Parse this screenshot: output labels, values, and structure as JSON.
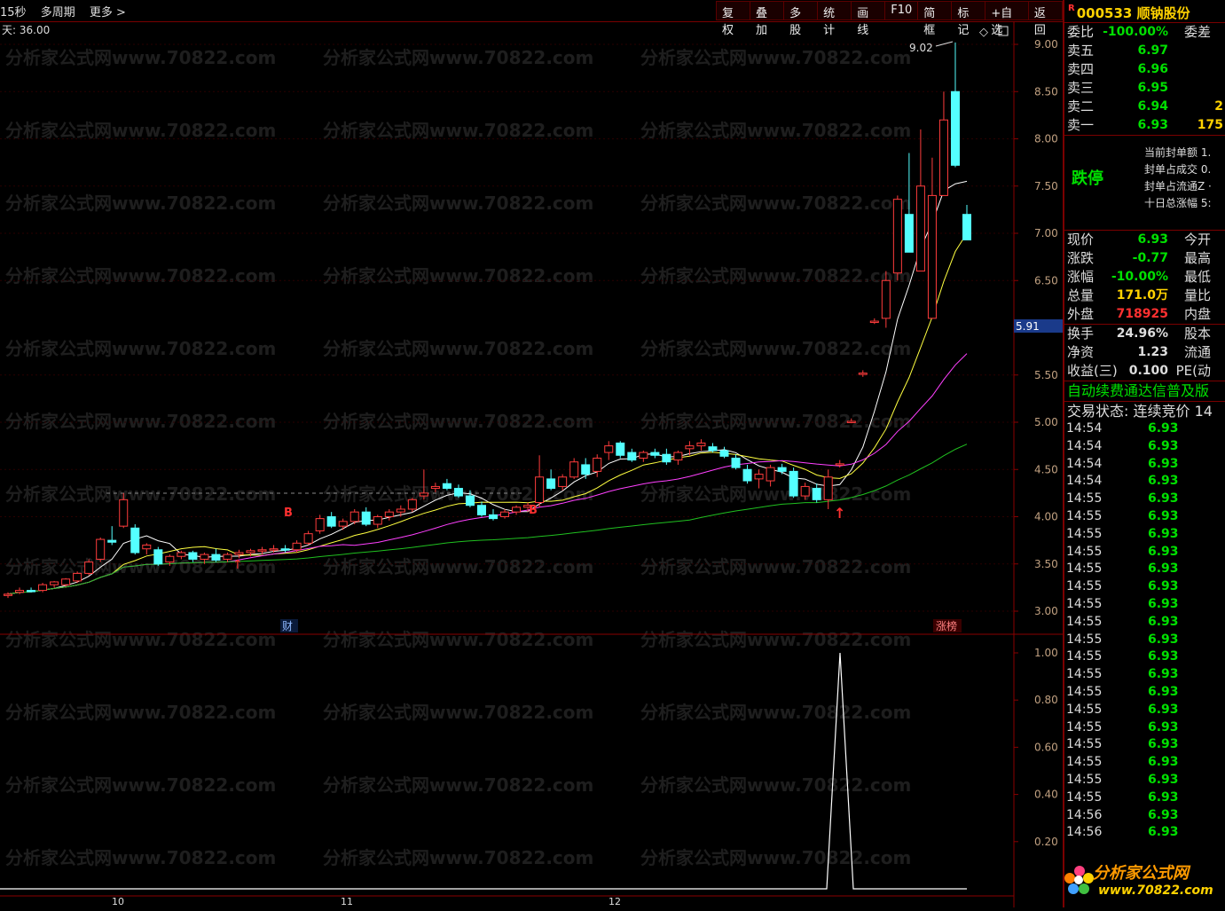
{
  "toolbar": {
    "left_items": [
      "15秒",
      "多周期",
      "更多 >"
    ],
    "buttons": [
      "复权",
      "叠加",
      "多股",
      "统计",
      "画线",
      "F10",
      "简框",
      "标记",
      "+自选",
      "返回"
    ]
  },
  "chart": {
    "corner_label": "天: 36.00",
    "watermark": "分析家公式网www.70822.com",
    "price_marker": "9.02",
    "current_price_badge": "5.91",
    "badge_cai": "财",
    "badge_zhang": "涨榜",
    "label_b": "B",
    "month_labels": [
      "10",
      "11",
      "12"
    ],
    "price_ticks": [
      "9.00",
      "8.50",
      "8.00",
      "7.50",
      "7.00",
      "6.50",
      "5.50",
      "5.00",
      "4.50",
      "4.00",
      "3.50",
      "3.00"
    ],
    "indicator_ticks": [
      "1.00",
      "0.80",
      "0.60",
      "0.40",
      "0.20"
    ]
  },
  "chart_data": {
    "type": "candlestick",
    "title": "",
    "ylim": [
      2.9,
      9.3
    ],
    "candles": [
      [
        3.17,
        3.2,
        3.14,
        3.18
      ],
      [
        3.2,
        3.25,
        3.18,
        3.22
      ],
      [
        3.22,
        3.25,
        3.2,
        3.21
      ],
      [
        3.22,
        3.3,
        3.2,
        3.28
      ],
      [
        3.28,
        3.32,
        3.25,
        3.31
      ],
      [
        3.28,
        3.35,
        3.26,
        3.34
      ],
      [
        3.32,
        3.42,
        3.3,
        3.4
      ],
      [
        3.4,
        3.55,
        3.38,
        3.52
      ],
      [
        3.55,
        3.78,
        3.52,
        3.76
      ],
      [
        3.75,
        3.9,
        3.7,
        3.73
      ],
      [
        3.9,
        4.25,
        3.88,
        4.18
      ],
      [
        3.88,
        3.92,
        3.6,
        3.62
      ],
      [
        3.66,
        3.72,
        3.6,
        3.7
      ],
      [
        3.65,
        3.68,
        3.48,
        3.5
      ],
      [
        3.52,
        3.6,
        3.48,
        3.58
      ],
      [
        3.58,
        3.64,
        3.55,
        3.62
      ],
      [
        3.62,
        3.64,
        3.52,
        3.55
      ],
      [
        3.55,
        3.62,
        3.5,
        3.6
      ],
      [
        3.6,
        3.66,
        3.52,
        3.54
      ],
      [
        3.55,
        3.62,
        3.52,
        3.6
      ],
      [
        3.6,
        3.65,
        3.56,
        3.62
      ],
      [
        3.62,
        3.66,
        3.58,
        3.64
      ],
      [
        3.64,
        3.68,
        3.6,
        3.65
      ],
      [
        3.65,
        3.7,
        3.62,
        3.66
      ],
      [
        3.66,
        3.7,
        3.62,
        3.65
      ],
      [
        3.65,
        3.75,
        3.62,
        3.72
      ],
      [
        3.72,
        3.85,
        3.7,
        3.82
      ],
      [
        3.85,
        4.02,
        3.82,
        3.98
      ],
      [
        4.0,
        4.05,
        3.88,
        3.9
      ],
      [
        3.9,
        3.98,
        3.86,
        3.95
      ],
      [
        3.95,
        4.08,
        3.92,
        4.05
      ],
      [
        4.05,
        4.1,
        3.9,
        3.92
      ],
      [
        3.92,
        4.02,
        3.88,
        4.0
      ],
      [
        4.0,
        4.08,
        3.96,
        4.05
      ],
      [
        4.05,
        4.12,
        4.0,
        4.08
      ],
      [
        4.08,
        4.2,
        4.05,
        4.18
      ],
      [
        4.22,
        4.5,
        4.18,
        4.25
      ],
      [
        4.3,
        4.36,
        4.26,
        4.32
      ],
      [
        4.35,
        4.4,
        4.28,
        4.3
      ],
      [
        4.3,
        4.34,
        4.2,
        4.22
      ],
      [
        4.22,
        4.28,
        4.1,
        4.12
      ],
      [
        4.12,
        4.16,
        4.0,
        4.02
      ],
      [
        4.02,
        4.08,
        3.96,
        3.98
      ],
      [
        4.0,
        4.08,
        3.98,
        4.05
      ],
      [
        4.05,
        4.12,
        4.02,
        4.1
      ],
      [
        4.1,
        4.15,
        4.05,
        4.12
      ],
      [
        4.15,
        4.65,
        4.1,
        4.42
      ],
      [
        4.4,
        4.5,
        4.28,
        4.3
      ],
      [
        4.32,
        4.45,
        4.28,
        4.42
      ],
      [
        4.42,
        4.62,
        4.4,
        4.58
      ],
      [
        4.55,
        4.62,
        4.4,
        4.45
      ],
      [
        4.48,
        4.66,
        4.42,
        4.62
      ],
      [
        4.68,
        4.8,
        4.6,
        4.75
      ],
      [
        4.78,
        4.8,
        4.62,
        4.65
      ],
      [
        4.68,
        4.72,
        4.58,
        4.6
      ],
      [
        4.62,
        4.7,
        4.58,
        4.68
      ],
      [
        4.68,
        4.72,
        4.62,
        4.65
      ],
      [
        4.66,
        4.72,
        4.55,
        4.58
      ],
      [
        4.6,
        4.7,
        4.55,
        4.68
      ],
      [
        4.72,
        4.8,
        4.65,
        4.75
      ],
      [
        4.75,
        4.82,
        4.7,
        4.78
      ],
      [
        4.74,
        4.78,
        4.68,
        4.7
      ],
      [
        4.7,
        4.74,
        4.62,
        4.64
      ],
      [
        4.62,
        4.66,
        4.5,
        4.52
      ],
      [
        4.5,
        4.55,
        4.35,
        4.38
      ],
      [
        4.4,
        4.5,
        4.3,
        4.45
      ],
      [
        4.38,
        4.55,
        4.32,
        4.52
      ],
      [
        4.52,
        4.56,
        4.45,
        4.48
      ],
      [
        4.48,
        4.52,
        4.2,
        4.22
      ],
      [
        4.22,
        4.36,
        4.18,
        4.32
      ],
      [
        4.3,
        4.35,
        4.15,
        4.18
      ],
      [
        4.18,
        4.5,
        4.08,
        4.42
      ],
      [
        4.55,
        4.6,
        4.52,
        4.56
      ],
      [
        5.01,
        5.04,
        4.99,
        5.01
      ],
      [
        5.52,
        5.55,
        5.48,
        5.52
      ],
      [
        6.07,
        6.1,
        6.04,
        6.07
      ],
      [
        6.1,
        6.6,
        6.0,
        6.5
      ],
      [
        6.58,
        7.4,
        6.5,
        7.36
      ],
      [
        7.2,
        7.85,
        6.8,
        6.8
      ],
      [
        6.6,
        8.1,
        6.6,
        7.5
      ],
      [
        6.1,
        7.8,
        6.1,
        7.4
      ],
      [
        7.4,
        8.5,
        7.4,
        8.2
      ],
      [
        8.5,
        9.02,
        7.7,
        7.72
      ],
      [
        7.2,
        7.3,
        6.93,
        6.93
      ]
    ]
  },
  "quote": {
    "code": "000533",
    "name": "顺钠股份",
    "rows1": [
      {
        "label": "委比",
        "value": "-100.00%",
        "extra": "委差",
        "vol": ""
      },
      {
        "label": "卖五",
        "value": "6.97",
        "extra": "",
        "vol": ""
      },
      {
        "label": "卖四",
        "value": "6.96",
        "extra": "",
        "vol": ""
      },
      {
        "label": "卖三",
        "value": "6.95",
        "extra": "",
        "vol": ""
      },
      {
        "label": "卖二",
        "value": "6.94",
        "extra": "",
        "vol": "2"
      },
      {
        "label": "卖一",
        "value": "6.93",
        "extra": "",
        "vol": "175"
      }
    ],
    "limit_label": "跌停",
    "limit_items": [
      "当前封单额 1.",
      "封单占成交 0.",
      "封单占流通Z ·",
      "十日总涨幅 5:"
    ],
    "rows2": [
      {
        "label": "现价",
        "value": "6.93",
        "extra": "今开"
      },
      {
        "label": "涨跌",
        "value": "-0.77",
        "extra": "最高"
      },
      {
        "label": "涨幅",
        "value": "-10.00%",
        "extra": "最低"
      },
      {
        "label": "总量",
        "value": "171.0万",
        "extra": "量比"
      },
      {
        "label": "外盘",
        "value": "718925",
        "extra": "内盘"
      }
    ],
    "rows3": [
      {
        "label": "换手",
        "value": "24.96%",
        "extra": "股本"
      },
      {
        "label": "净资",
        "value": "1.23",
        "extra": "流通"
      },
      {
        "label": "收益(三)",
        "value": "0.100",
        "extra": "PE(动"
      }
    ],
    "ticker": "自动续费通达信普及版",
    "status": "交易状态: 连续竞价 14",
    "ticks": [
      {
        "t": "14:54",
        "p": "6.93"
      },
      {
        "t": "14:54",
        "p": "6.93"
      },
      {
        "t": "14:54",
        "p": "6.93"
      },
      {
        "t": "14:54",
        "p": "6.93"
      },
      {
        "t": "14:55",
        "p": "6.93"
      },
      {
        "t": "14:55",
        "p": "6.93"
      },
      {
        "t": "14:55",
        "p": "6.93"
      },
      {
        "t": "14:55",
        "p": "6.93"
      },
      {
        "t": "14:55",
        "p": "6.93"
      },
      {
        "t": "14:55",
        "p": "6.93"
      },
      {
        "t": "14:55",
        "p": "6.93"
      },
      {
        "t": "14:55",
        "p": "6.93"
      },
      {
        "t": "14:55",
        "p": "6.93"
      },
      {
        "t": "14:55",
        "p": "6.93"
      },
      {
        "t": "14:55",
        "p": "6.93"
      },
      {
        "t": "14:55",
        "p": "6.93"
      },
      {
        "t": "14:55",
        "p": "6.93"
      },
      {
        "t": "14:55",
        "p": "6.93"
      },
      {
        "t": "14:55",
        "p": "6.93"
      },
      {
        "t": "14:55",
        "p": "6.93"
      },
      {
        "t": "14:55",
        "p": "6.93"
      },
      {
        "t": "14:55",
        "p": "6.93"
      },
      {
        "t": "14:56",
        "p": "6.93"
      },
      {
        "t": "14:56",
        "p": "6.93"
      }
    ],
    "logo1": "分析家公式网",
    "logo2": "www.70822.com"
  }
}
